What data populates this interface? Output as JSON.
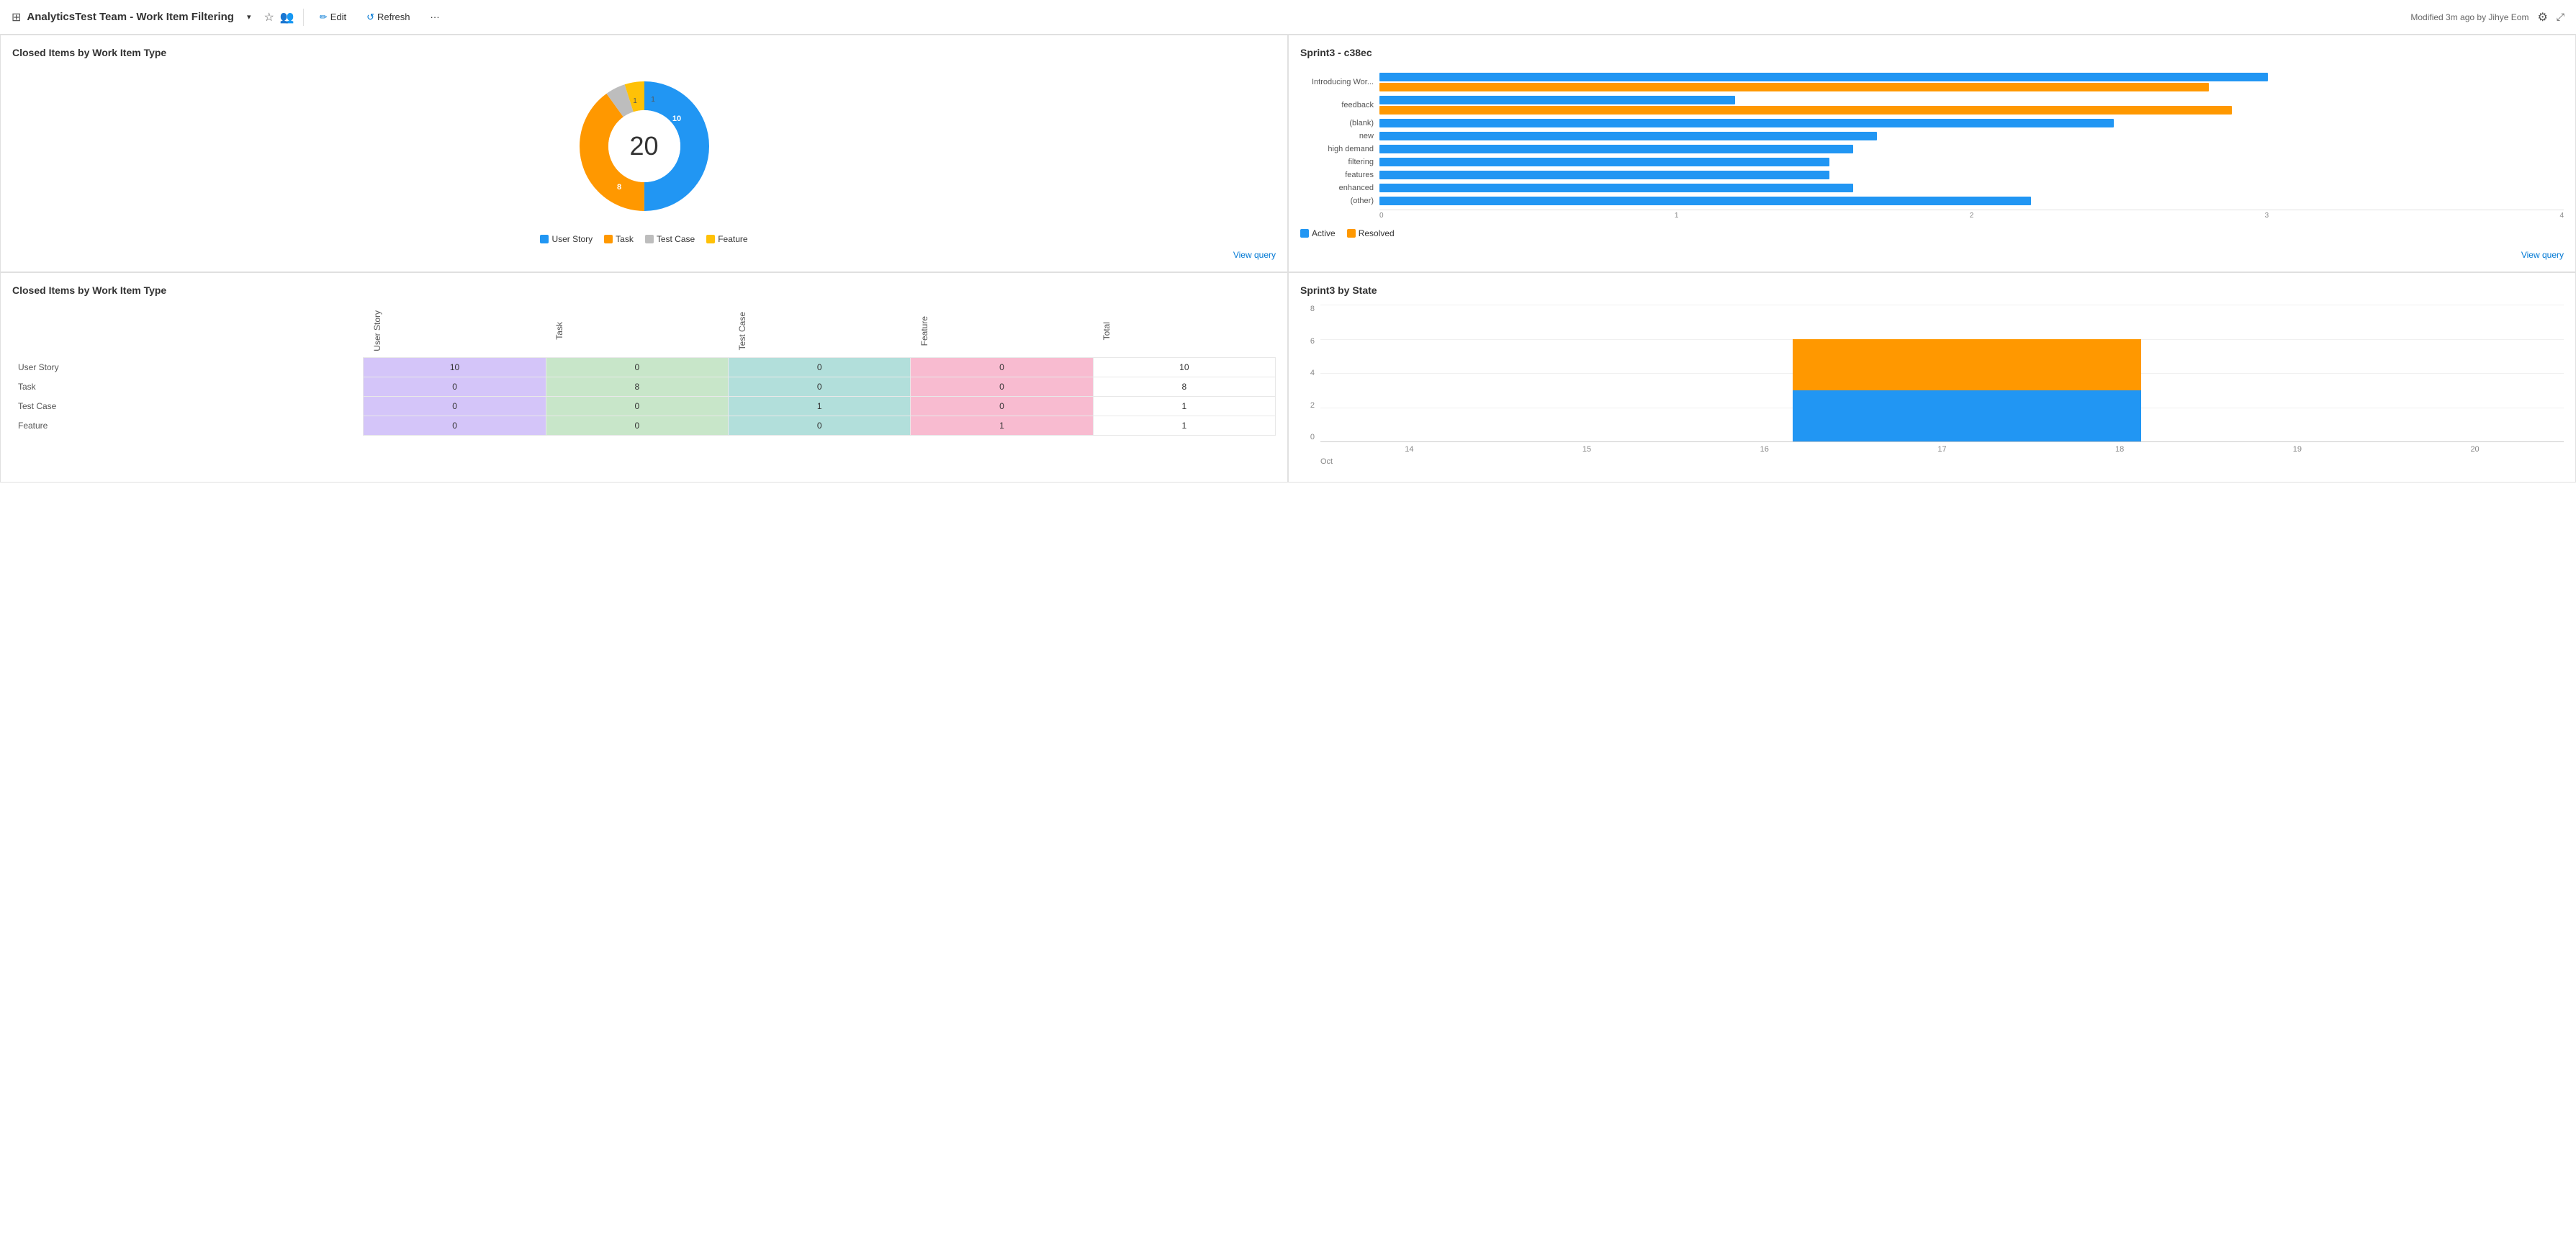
{
  "header": {
    "grid_icon": "⊞",
    "title": "AnalyticsTest Team - Work Item Filtering",
    "chevron": "▾",
    "edit_label": "Edit",
    "refresh_label": "Refresh",
    "more_label": "···",
    "modified_text": "Modified 3m ago by Jihye Eom"
  },
  "donut_chart": {
    "title": "Closed Items by Work Item Type",
    "total": "20",
    "segments": [
      {
        "label": "User Story",
        "value": 10,
        "color": "#2196F3",
        "percent": 50
      },
      {
        "label": "Task",
        "value": 8,
        "color": "#FF9800",
        "percent": 40
      },
      {
        "label": "Test Case",
        "value": 1,
        "color": "#bdbdbd",
        "percent": 5
      },
      {
        "label": "Feature",
        "value": 1,
        "color": "#FFC107",
        "percent": 5
      }
    ],
    "view_query": "View query"
  },
  "bar_chart": {
    "title": "Sprint3 - c38ec",
    "rows": [
      {
        "label": "Introducing Wor...",
        "active": 75,
        "resolved": 70
      },
      {
        "label": "feedback",
        "active": 30,
        "resolved": 72
      },
      {
        "label": "(blank)",
        "active": 65,
        "resolved": 0
      },
      {
        "label": "new",
        "active": 45,
        "resolved": 0
      },
      {
        "label": "high demand",
        "active": 43,
        "resolved": 0
      },
      {
        "label": "filtering",
        "active": 41,
        "resolved": 0
      },
      {
        "label": "features",
        "active": 41,
        "resolved": 0
      },
      {
        "label": "enhanced",
        "active": 43,
        "resolved": 0
      },
      {
        "label": "(other)",
        "active": 58,
        "resolved": 0
      }
    ],
    "axis": [
      "0",
      "1",
      "2",
      "3",
      "4"
    ],
    "legend": {
      "active": "Active",
      "resolved": "Resolved"
    },
    "view_query": "View query"
  },
  "pivot_table": {
    "title": "Closed Items by Work Item Type",
    "col_headers": [
      "User Story",
      "Task",
      "Test Case",
      "Feature",
      "Total"
    ],
    "rows": [
      {
        "label": "User Story",
        "values": [
          10,
          0,
          0,
          0,
          10
        ],
        "classes": [
          "cell-us",
          "cell-task",
          "cell-tc",
          "cell-feat",
          ""
        ]
      },
      {
        "label": "Task",
        "values": [
          0,
          8,
          0,
          0,
          8
        ],
        "classes": [
          "cell-us",
          "cell-task",
          "cell-tc",
          "cell-feat",
          ""
        ]
      },
      {
        "label": "Test Case",
        "values": [
          0,
          0,
          1,
          0,
          1
        ],
        "classes": [
          "cell-us",
          "cell-task",
          "cell-tc",
          "cell-feat",
          ""
        ]
      },
      {
        "label": "Feature",
        "values": [
          0,
          0,
          0,
          1,
          1
        ],
        "classes": [
          "cell-us",
          "cell-task",
          "cell-tc",
          "cell-feat",
          ""
        ]
      }
    ]
  },
  "state_chart": {
    "title": "Sprint3 by State",
    "y_labels": [
      "8",
      "6",
      "4",
      "2",
      "0"
    ],
    "x_labels": [
      "14",
      "15",
      "16",
      "17",
      "18",
      "19",
      "20"
    ],
    "x_month": "Oct",
    "active_height": 100,
    "resolved_height": 100
  },
  "colors": {
    "blue": "#2196F3",
    "orange": "#FF9800",
    "gray": "#bdbdbd",
    "yellow": "#FFC107",
    "link": "#0078d4"
  }
}
